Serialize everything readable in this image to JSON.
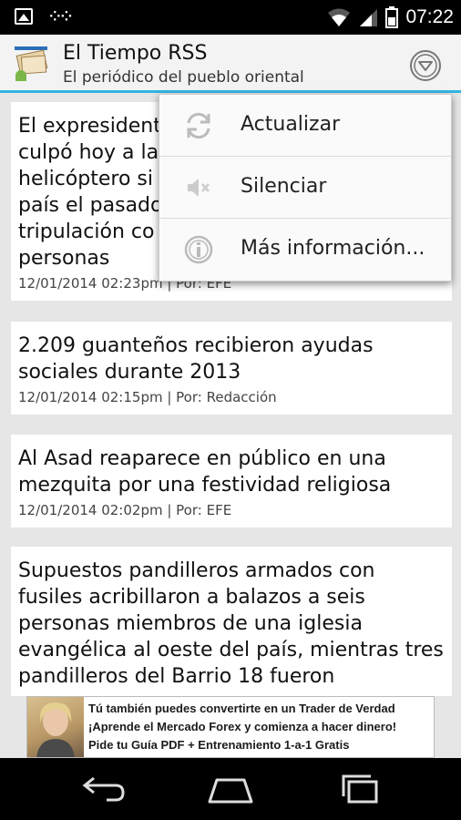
{
  "status_bar": {
    "time": "07:22"
  },
  "action_bar": {
    "title": "El Tiempo RSS",
    "subtitle": "El periódico del pueblo oriental"
  },
  "articles": [
    {
      "lines": [
        "El expresident",
        "culpó hoy a la",
        "helicóptero si",
        "país el pasado",
        "tripulación co",
        "personas"
      ],
      "meta": "12/01/2014 02:23pm | Por: EFE"
    },
    {
      "lines": [
        "2.209 guanteños recibieron ayudas",
        "sociales durante 2013"
      ],
      "meta": "12/01/2014 02:15pm | Por: Redacción"
    },
    {
      "lines": [
        "Al Asad reaparece en público en una",
        "mezquita por una festividad religiosa"
      ],
      "meta": "12/01/2014 02:02pm | Por: EFE"
    },
    {
      "lines": [
        "Supuestos pandilleros armados con",
        "fusiles acribillaron a balazos a seis",
        "personas miembros de una iglesia",
        "evangélica al oeste del país, mientras tres",
        "pandilleros del Barrio 18 fueron"
      ],
      "meta": ""
    }
  ],
  "menu": {
    "items": [
      {
        "label": "Actualizar",
        "icon": "refresh-icon"
      },
      {
        "label": "Silenciar",
        "icon": "mute-icon"
      },
      {
        "label": "Más información...",
        "icon": "info-icon"
      }
    ]
  },
  "ad": {
    "line1": "Tú también puedes convertirte en un Trader de Verdad",
    "line2": "¡Aprende el Mercado Forex y comienza a hacer dinero!",
    "line3": "Pide tu Guía PDF + Entrenamiento 1-a-1 Gratis"
  },
  "colors": {
    "accent": "#33b5e5",
    "action_bar_bg": "#f3f3f3",
    "list_bg": "#e6e6e6",
    "status_bar_bg": "#000000"
  }
}
